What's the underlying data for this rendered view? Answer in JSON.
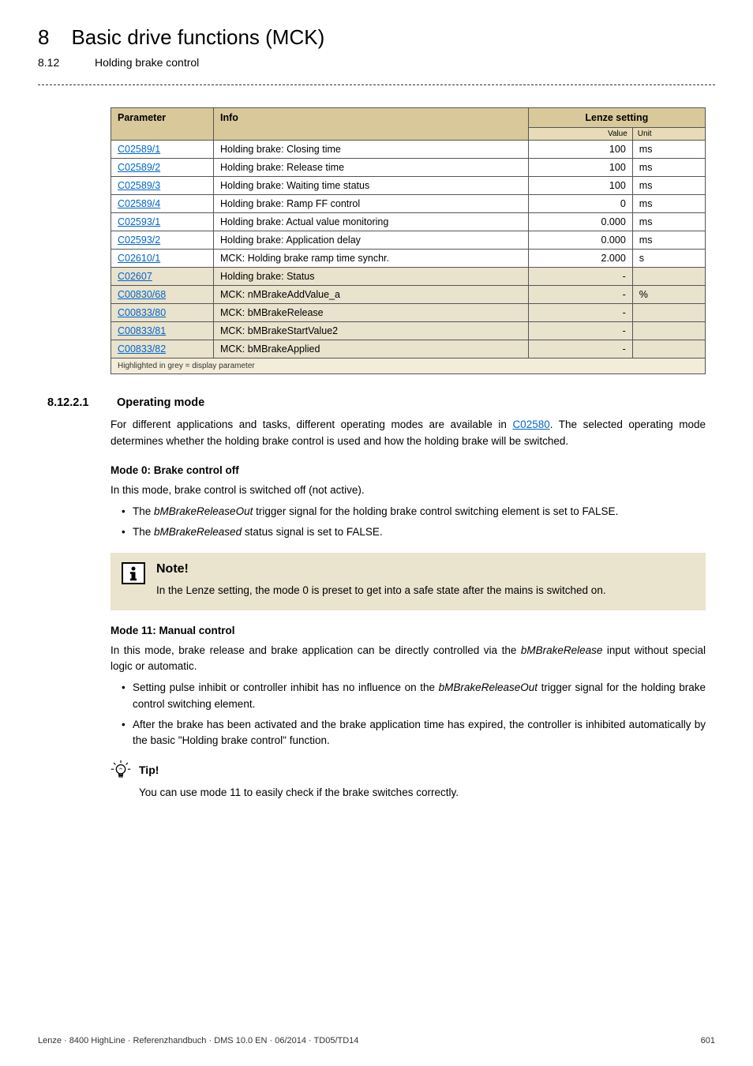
{
  "header": {
    "chapter_num": "8",
    "chapter_title": "Basic drive functions (MCK)",
    "sub_num": "8.12",
    "sub_title": "Holding brake control"
  },
  "table": {
    "col_parameter": "Parameter",
    "col_info": "Info",
    "col_lenze": "Lenze setting",
    "sub_value": "Value",
    "sub_unit": "Unit",
    "rows": [
      {
        "p": "C02589/1",
        "info": "Holding brake: Closing time",
        "val": "100",
        "unit": "ms",
        "grey": false
      },
      {
        "p": "C02589/2",
        "info": "Holding brake: Release time",
        "val": "100",
        "unit": "ms",
        "grey": false
      },
      {
        "p": "C02589/3",
        "info": "Holding brake: Waiting time status",
        "val": "100",
        "unit": "ms",
        "grey": false
      },
      {
        "p": "C02589/4",
        "info": "Holding brake: Ramp FF control",
        "val": "0",
        "unit": "ms",
        "grey": false
      },
      {
        "p": "C02593/1",
        "info": "Holding brake: Actual value monitoring",
        "val": "0.000",
        "unit": "ms",
        "grey": false
      },
      {
        "p": "C02593/2",
        "info": "Holding brake: Application delay",
        "val": "0.000",
        "unit": "ms",
        "grey": false
      },
      {
        "p": "C02610/1",
        "info": "MCK: Holding brake ramp time synchr.",
        "val": "2.000",
        "unit": "s",
        "grey": false
      },
      {
        "p": "C02607",
        "info": "Holding brake: Status",
        "val": "-",
        "unit": "",
        "grey": true
      },
      {
        "p": "C00830/68",
        "info": "MCK: nMBrakeAddValue_a",
        "val": "-",
        "unit": "%",
        "grey": true
      },
      {
        "p": "C00833/80",
        "info": "MCK: bMBrakeRelease",
        "val": "-",
        "unit": "",
        "grey": true
      },
      {
        "p": "C00833/81",
        "info": "MCK: bMBrakeStartValue2",
        "val": "-",
        "unit": "",
        "grey": true
      },
      {
        "p": "C00833/82",
        "info": "MCK: bMBrakeApplied",
        "val": "-",
        "unit": "",
        "grey": true
      }
    ],
    "footnote": "Highlighted in grey = display parameter"
  },
  "section": {
    "num": "8.12.2.1",
    "title": "Operating mode",
    "intro_pre": "For different applications and tasks, different operating modes are available in ",
    "intro_link": "C02580",
    "intro_post": ". The selected operating mode determines whether the holding brake control is used and how the holding brake will be switched.",
    "mode0_title": "Mode 0: Brake control off",
    "mode0_intro": "In this mode, brake control is switched off (not active).",
    "mode0_b1_pre": "The ",
    "mode0_b1_em": "bMBrakeReleaseOut",
    "mode0_b1_post": " trigger signal for the holding brake control switching element is set to FALSE.",
    "mode0_b2_pre": "The ",
    "mode0_b2_em": "bMBrakeReleased",
    "mode0_b2_post": " status signal is set to FALSE.",
    "note_title": "Note!",
    "note_text": "In the Lenze setting, the mode 0 is preset to get into a safe state after the mains is switched on.",
    "mode11_title": "Mode 11: Manual control",
    "mode11_intro_pre": "In this mode, brake release and brake application can be directly controlled via the ",
    "mode11_intro_em": "bMBrakeRelease",
    "mode11_intro_post": " input without special logic or automatic.",
    "mode11_b1_pre": "Setting pulse inhibit or controller inhibit has no influence on the ",
    "mode11_b1_em": "bMBrakeReleaseOut",
    "mode11_b1_post": " trigger signal for the holding brake control switching element.",
    "mode11_b2": "After the brake has been activated and the brake application time has expired, the controller is inhibited automatically by the basic \"Holding brake control\" function.",
    "tip_title": "Tip!",
    "tip_text": "You can use mode 11 to easily check if the brake switches correctly."
  },
  "footer": {
    "left": "Lenze · 8400 HighLine · Referenzhandbuch · DMS 10.0 EN · 06/2014 · TD05/TD14",
    "page": "601"
  }
}
